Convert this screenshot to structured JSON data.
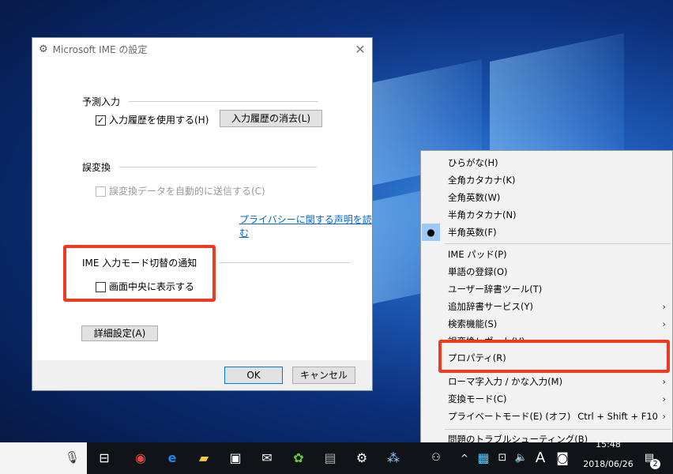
{
  "dialog": {
    "title": "Microsoft IME の設定",
    "close": "✕",
    "section1": {
      "heading": "予測入力",
      "checkbox_label": "入力履歴を使用する(H)",
      "checked": true,
      "clear_button": "入力履歴の消去(L)"
    },
    "section2": {
      "heading": "誤変換",
      "checkbox_label": "誤変換データを自動的に送信する(C)",
      "checked": false,
      "disabled": true,
      "privacy_link": "プライバシーに関する声明を読む"
    },
    "section3": {
      "heading": "IME 入力モード切替の通知",
      "checkbox_label": "画面中央に表示する",
      "checked": false
    },
    "advanced_button": "詳細設定(A)",
    "ok_button": "OK",
    "cancel_button": "キャンセル"
  },
  "menu": {
    "items": [
      {
        "label": "ひらがな(H)"
      },
      {
        "label": "全角カタカナ(K)"
      },
      {
        "label": "全角英数(W)"
      },
      {
        "label": "半角カタカナ(N)"
      },
      {
        "label": "半角英数(F)",
        "selected": true
      },
      {
        "label": "IME パッド(P)"
      },
      {
        "label": "単語の登録(O)"
      },
      {
        "label": "ユーザー辞書ツール(T)"
      },
      {
        "label": "追加辞書サービス(Y)",
        "submenu": "›"
      },
      {
        "label": "検索機能(S)",
        "submenu": "›"
      },
      {
        "label": "誤変換レポート(V)"
      },
      {
        "label": "プロパティ(R)"
      },
      {
        "label": "ローマ字入力 / かな入力(M)",
        "submenu": "›"
      },
      {
        "label": "変換モード(C)",
        "submenu": "›"
      },
      {
        "label": "プライベートモード(E) (オフ)",
        "shortcut": "Ctrl + Shift + F10",
        "submenu": "›"
      },
      {
        "label": "問題のトラブルシューティング(B)"
      }
    ],
    "bullet": "●"
  },
  "taskbar": {
    "time": "15:48",
    "date": "2018/06/26",
    "notifications": "2",
    "ime_mode": "A"
  },
  "colors": {
    "highlight": "#ef3a22",
    "menu_selected": "#9ec8f5",
    "link": "#0066cc"
  }
}
